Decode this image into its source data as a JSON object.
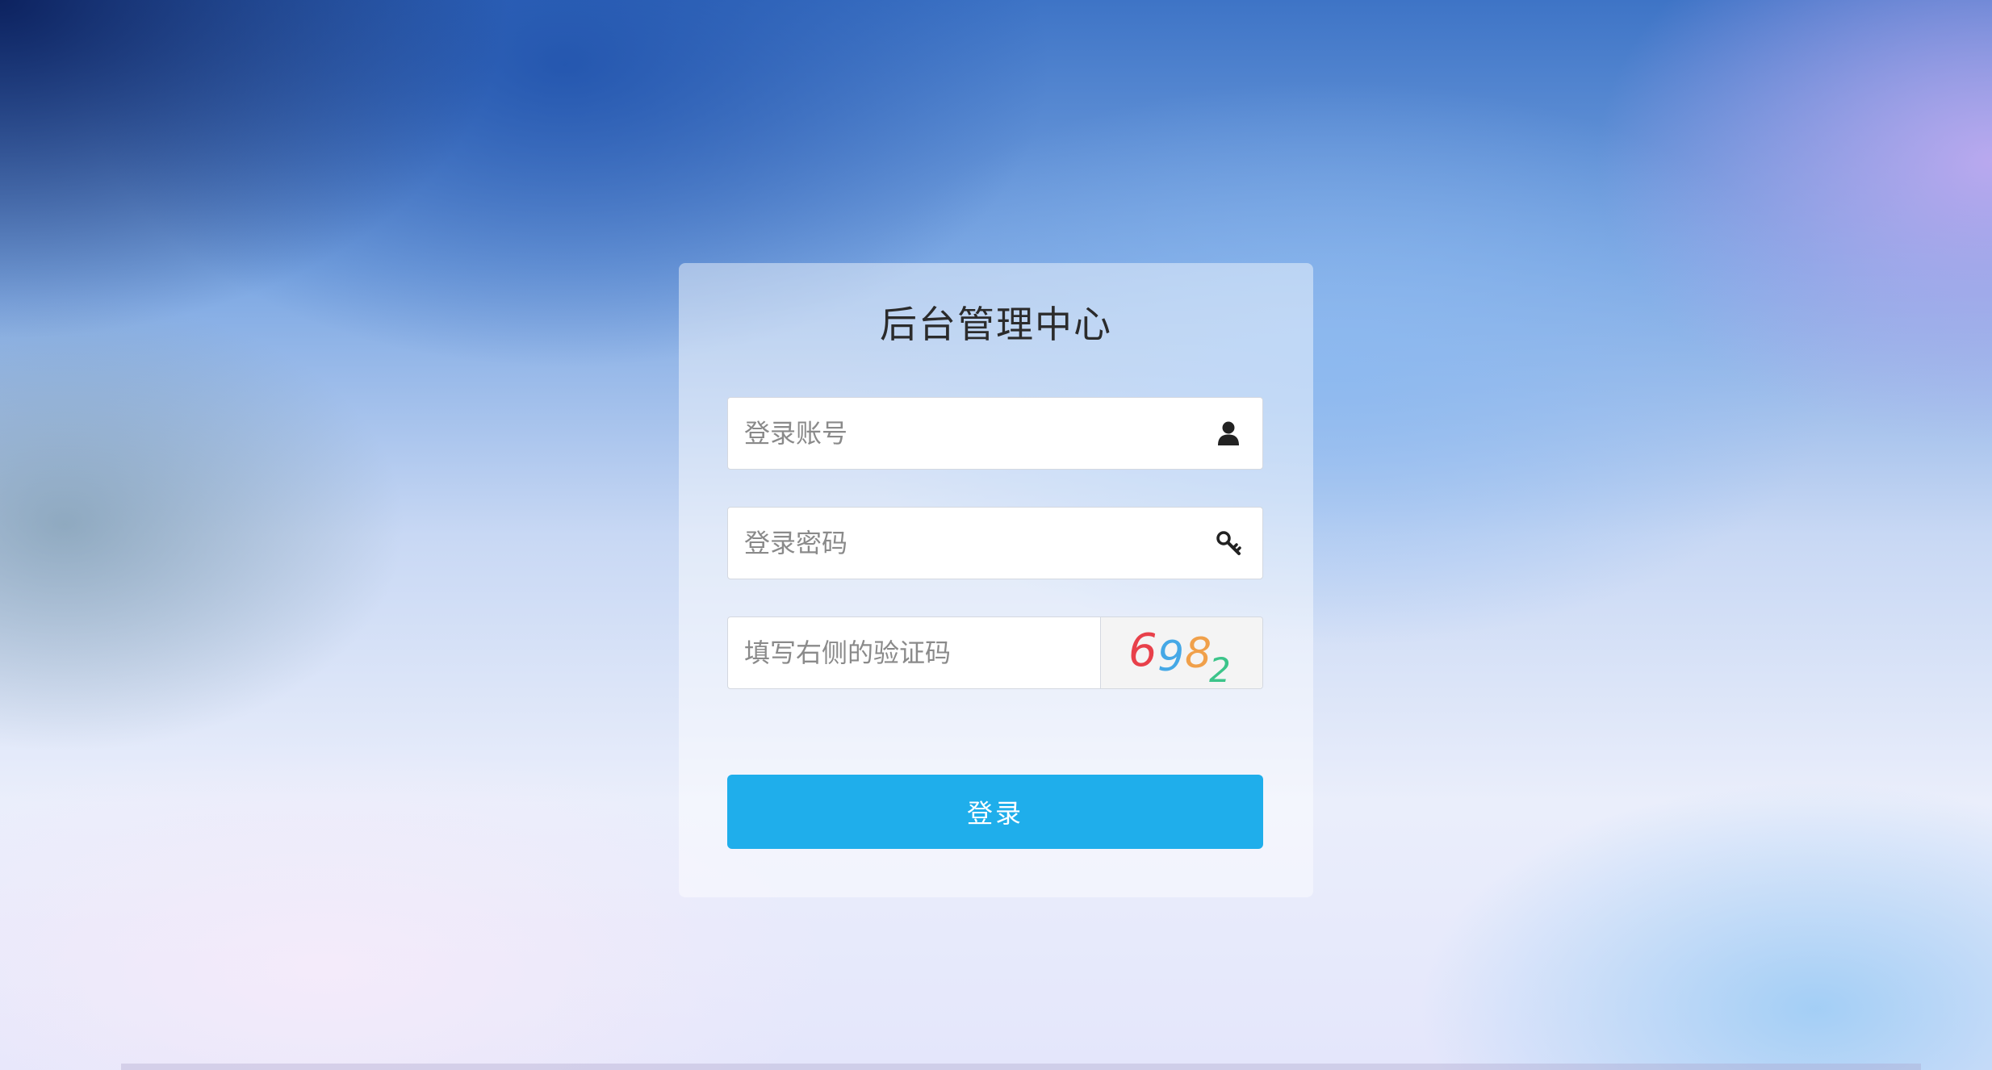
{
  "page": {
    "title": "后台管理中心"
  },
  "form": {
    "account": {
      "placeholder": "登录账号",
      "value": "",
      "icon": "user-icon"
    },
    "password": {
      "placeholder": "登录密码",
      "value": "",
      "icon": "key-icon"
    },
    "captcha": {
      "placeholder": "填写右侧的验证码",
      "value": "",
      "image_text": "6982",
      "image_colors": [
        "#e8404a",
        "#45a8e6",
        "#f0a04a",
        "#3cc48a"
      ]
    },
    "submit_label": "登录"
  },
  "colors": {
    "button": "#1faeeb",
    "card": "rgba(255,255,255,0.45)"
  }
}
